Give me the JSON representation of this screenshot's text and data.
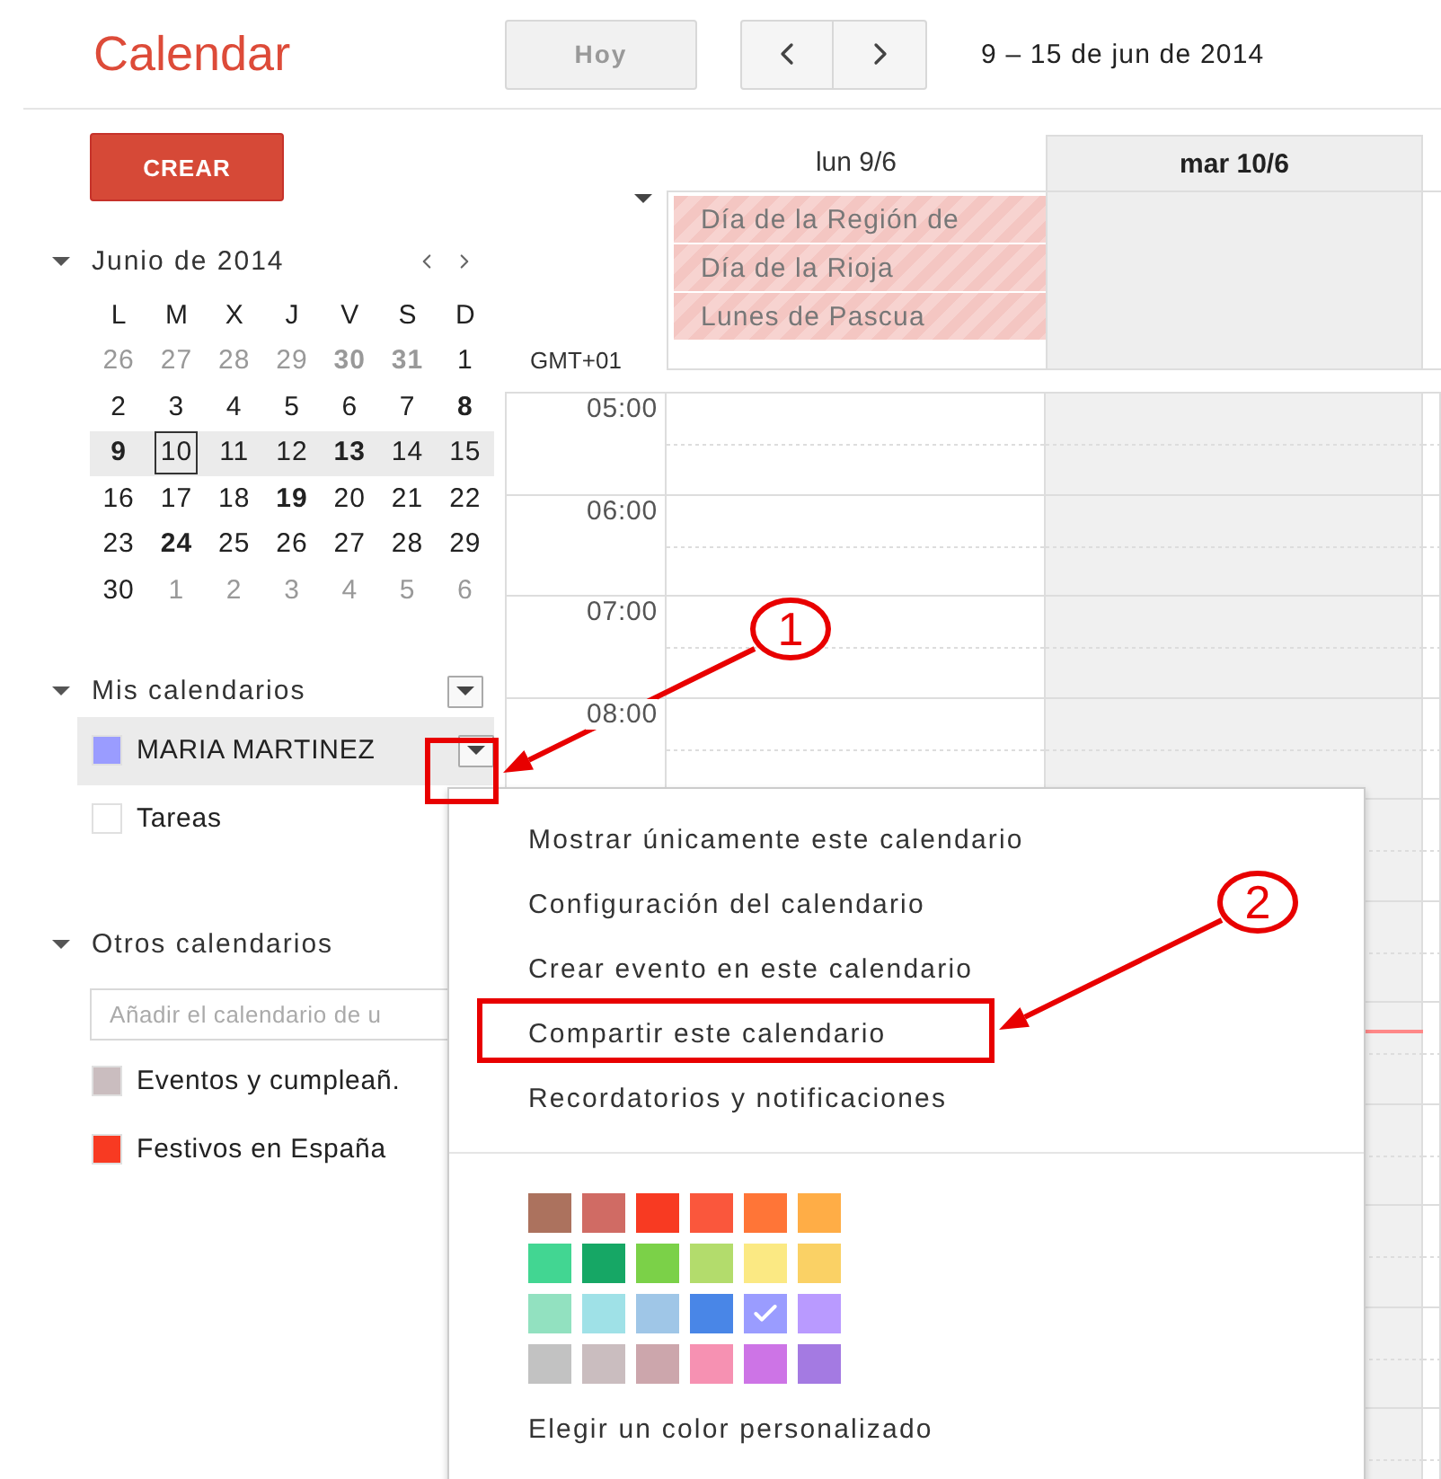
{
  "header": {
    "logo": "Calendar",
    "today_button": "Hoy",
    "date_range": "9 – 15 de jun de 2014"
  },
  "sidebar": {
    "create_button": "CREAR",
    "mini_calendar": {
      "title": "Junio de 2014",
      "expanded": true,
      "weekdays": [
        "L",
        "M",
        "X",
        "J",
        "V",
        "S",
        "D"
      ],
      "weeks": [
        {
          "selected": false,
          "days": [
            {
              "label": "26",
              "other_month": true,
              "bold": false,
              "today": false
            },
            {
              "label": "27",
              "other_month": true,
              "bold": false,
              "today": false
            },
            {
              "label": "28",
              "other_month": true,
              "bold": false,
              "today": false
            },
            {
              "label": "29",
              "other_month": true,
              "bold": false,
              "today": false
            },
            {
              "label": "30",
              "other_month": true,
              "bold": true,
              "today": false
            },
            {
              "label": "31",
              "other_month": true,
              "bold": true,
              "today": false
            },
            {
              "label": "1",
              "other_month": false,
              "bold": false,
              "today": false
            }
          ]
        },
        {
          "selected": false,
          "days": [
            {
              "label": "2",
              "other_month": false,
              "bold": false,
              "today": false
            },
            {
              "label": "3",
              "other_month": false,
              "bold": false,
              "today": false
            },
            {
              "label": "4",
              "other_month": false,
              "bold": false,
              "today": false
            },
            {
              "label": "5",
              "other_month": false,
              "bold": false,
              "today": false
            },
            {
              "label": "6",
              "other_month": false,
              "bold": false,
              "today": false
            },
            {
              "label": "7",
              "other_month": false,
              "bold": false,
              "today": false
            },
            {
              "label": "8",
              "other_month": false,
              "bold": true,
              "today": false
            }
          ]
        },
        {
          "selected": true,
          "days": [
            {
              "label": "9",
              "other_month": false,
              "bold": true,
              "today": false
            },
            {
              "label": "10",
              "other_month": false,
              "bold": false,
              "today": true
            },
            {
              "label": "11",
              "other_month": false,
              "bold": false,
              "today": false
            },
            {
              "label": "12",
              "other_month": false,
              "bold": false,
              "today": false
            },
            {
              "label": "13",
              "other_month": false,
              "bold": true,
              "today": false
            },
            {
              "label": "14",
              "other_month": false,
              "bold": false,
              "today": false
            },
            {
              "label": "15",
              "other_month": false,
              "bold": false,
              "today": false
            }
          ]
        },
        {
          "selected": false,
          "days": [
            {
              "label": "16",
              "other_month": false,
              "bold": false,
              "today": false
            },
            {
              "label": "17",
              "other_month": false,
              "bold": false,
              "today": false
            },
            {
              "label": "18",
              "other_month": false,
              "bold": false,
              "today": false
            },
            {
              "label": "19",
              "other_month": false,
              "bold": true,
              "today": false
            },
            {
              "label": "20",
              "other_month": false,
              "bold": false,
              "today": false
            },
            {
              "label": "21",
              "other_month": false,
              "bold": false,
              "today": false
            },
            {
              "label": "22",
              "other_month": false,
              "bold": false,
              "today": false
            }
          ]
        },
        {
          "selected": false,
          "days": [
            {
              "label": "23",
              "other_month": false,
              "bold": false,
              "today": false
            },
            {
              "label": "24",
              "other_month": false,
              "bold": true,
              "today": false
            },
            {
              "label": "25",
              "other_month": false,
              "bold": false,
              "today": false
            },
            {
              "label": "26",
              "other_month": false,
              "bold": false,
              "today": false
            },
            {
              "label": "27",
              "other_month": false,
              "bold": false,
              "today": false
            },
            {
              "label": "28",
              "other_month": false,
              "bold": false,
              "today": false
            },
            {
              "label": "29",
              "other_month": false,
              "bold": false,
              "today": false
            }
          ]
        },
        {
          "selected": false,
          "days": [
            {
              "label": "30",
              "other_month": false,
              "bold": false,
              "today": false
            },
            {
              "label": "1",
              "other_month": true,
              "bold": false,
              "today": false
            },
            {
              "label": "2",
              "other_month": true,
              "bold": false,
              "today": false
            },
            {
              "label": "3",
              "other_month": true,
              "bold": false,
              "today": false
            },
            {
              "label": "4",
              "other_month": true,
              "bold": false,
              "today": false
            },
            {
              "label": "5",
              "other_month": true,
              "bold": false,
              "today": false
            },
            {
              "label": "6",
              "other_month": true,
              "bold": false,
              "today": false
            }
          ]
        }
      ]
    },
    "my_calendars": {
      "title": "Mis calendarios",
      "expanded": true,
      "items": [
        {
          "name": "MARIA MARTINEZ",
          "color": "#9a9cff",
          "selected": true
        },
        {
          "name": "Tareas",
          "color": "#ffffff",
          "selected": false
        }
      ]
    },
    "other_calendars": {
      "title": "Otros calendarios",
      "expanded": true,
      "search": {
        "placeholder": "Añadir el calendario de u"
      },
      "items": [
        {
          "name": "Eventos y cumpleañ.",
          "color": "#cabdbf",
          "selected": false
        },
        {
          "name": "Festivos en España",
          "color": "#f83a22",
          "selected": false
        }
      ]
    }
  },
  "week_view": {
    "days": [
      {
        "label": "lun 9/6",
        "selected": false
      },
      {
        "label": "mar 10/6",
        "selected": true
      }
    ],
    "timezone": "GMT+01",
    "all_day_events": [
      {
        "title": "Día de la Región de"
      },
      {
        "title": "Día de la Rioja"
      },
      {
        "title": "Lunes de Pascua"
      }
    ],
    "hours": [
      "05:00",
      "06:00",
      "07:00",
      "08:00"
    ]
  },
  "context_menu": {
    "items": [
      "Mostrar únicamente este calendario",
      "Configuración del calendario",
      "Crear evento en este calendario",
      "Compartir este calendario",
      "Recordatorios y notificaciones"
    ],
    "swatches": [
      {
        "color": "#ac725e",
        "selected": false
      },
      {
        "color": "#d06b64",
        "selected": false
      },
      {
        "color": "#f83a22",
        "selected": false
      },
      {
        "color": "#fa573c",
        "selected": false
      },
      {
        "color": "#ff7537",
        "selected": false
      },
      {
        "color": "#ffad46",
        "selected": false
      },
      {
        "color": "#42d692",
        "selected": false
      },
      {
        "color": "#16a765",
        "selected": false
      },
      {
        "color": "#7bd148",
        "selected": false
      },
      {
        "color": "#b3dc6c",
        "selected": false
      },
      {
        "color": "#fbe983",
        "selected": false
      },
      {
        "color": "#fad165",
        "selected": false
      },
      {
        "color": "#92e1c0",
        "selected": false
      },
      {
        "color": "#9fe1e7",
        "selected": false
      },
      {
        "color": "#9fc6e7",
        "selected": false
      },
      {
        "color": "#4986e7",
        "selected": false
      },
      {
        "color": "#9a9cff",
        "selected": true
      },
      {
        "color": "#b99aff",
        "selected": false
      },
      {
        "color": "#c2c2c2",
        "selected": false
      },
      {
        "color": "#cabdbf",
        "selected": false
      },
      {
        "color": "#cca6ac",
        "selected": false
      },
      {
        "color": "#f691b2",
        "selected": false
      },
      {
        "color": "#cd74e6",
        "selected": false
      },
      {
        "color": "#a47ae2",
        "selected": false
      }
    ],
    "custom_color": "Elegir un color personalizado"
  },
  "annotations": [
    {
      "label": "1"
    },
    {
      "label": "2"
    }
  ]
}
